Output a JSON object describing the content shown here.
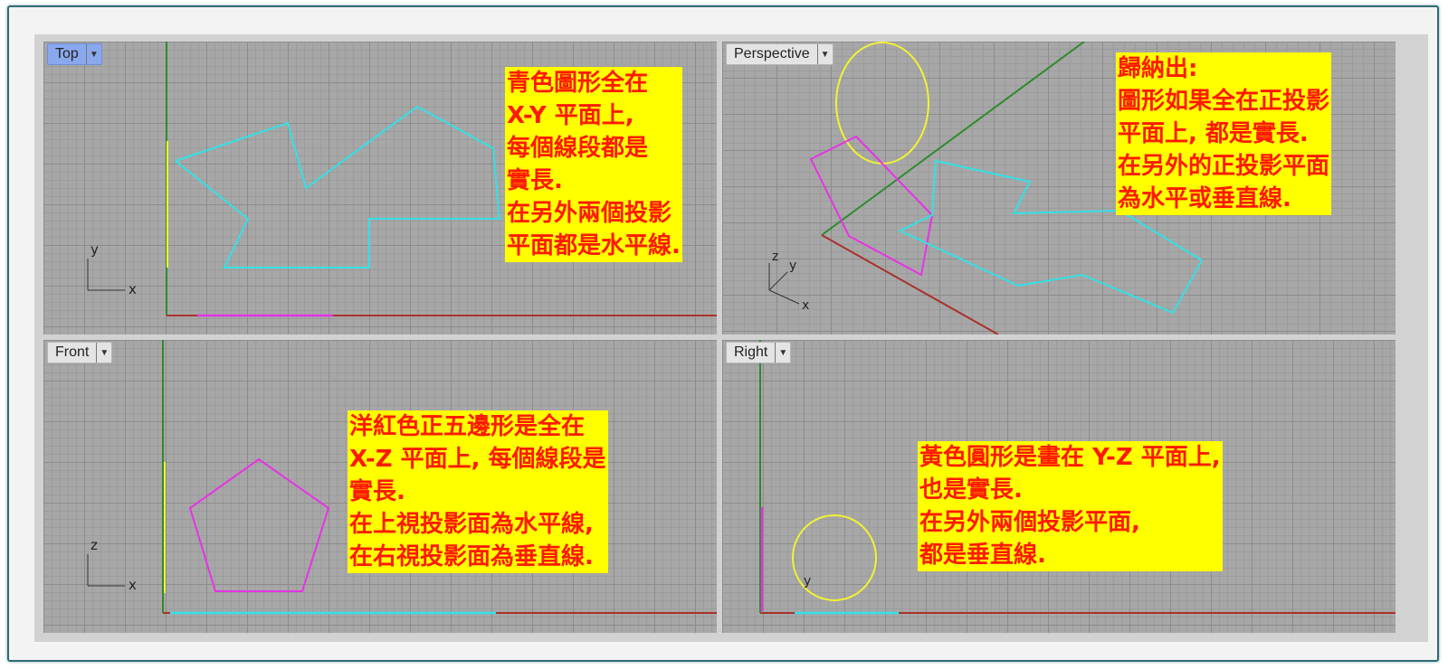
{
  "viewports": {
    "top": {
      "label": "Top",
      "note": "青色圖形全在\nX-Y 平面上,\n每個線段都是\n實長.\n在另外兩個投影\n平面都是水平線."
    },
    "perspective": {
      "label": "Perspective",
      "note": "歸納出:\n圖形如果全在正投影\n平面上, 都是實長.\n在另外的正投影平面\n為水平或垂直線."
    },
    "front": {
      "label": "Front",
      "note": "洋紅色正五邊形是全在\nX-Z 平面上, 每個線段是\n實長.\n在上視投影面為水平線,\n在右視投影面為垂直線."
    },
    "right": {
      "label": "Right",
      "note": "黃色圓形是畫在 Y-Z 平面上,\n也是實長.\n在另外兩個投影平面,\n都是垂直線."
    }
  },
  "axis_labels": {
    "x": "x",
    "y": "y",
    "z": "z"
  },
  "colors": {
    "cyan_shape": "#33e0e6",
    "magenta_shape": "#e633e6",
    "yellow_shape": "#f2f233",
    "x_axis": "#a8322c",
    "y_axis": "#2e8b2e",
    "note_text": "#ff1a00",
    "note_bg": "#ffff00"
  },
  "icons": {
    "dropdown": "dropdown-arrow-icon"
  }
}
